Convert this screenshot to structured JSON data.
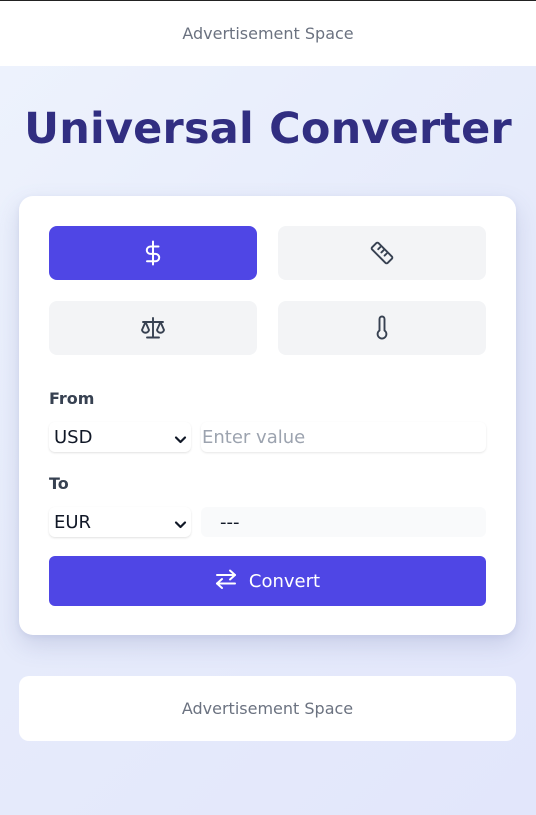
{
  "ads": {
    "top_label": "Advertisement Space",
    "bottom_label": "Advertisement Space"
  },
  "header": {
    "title": "Universal Converter"
  },
  "categories": [
    {
      "icon": "dollar-icon",
      "active": true
    },
    {
      "icon": "ruler-icon",
      "active": false
    },
    {
      "icon": "scale-icon",
      "active": false
    },
    {
      "icon": "thermometer-icon",
      "active": false
    }
  ],
  "converter": {
    "from_label": "From",
    "from_unit": "USD",
    "from_placeholder": "Enter value",
    "from_value": "",
    "to_label": "To",
    "to_unit": "EUR",
    "result": "---",
    "convert_label": "Convert"
  },
  "colors": {
    "accent": "#4f46e5",
    "title": "#312e81",
    "inactive_button": "#f3f4f6"
  }
}
